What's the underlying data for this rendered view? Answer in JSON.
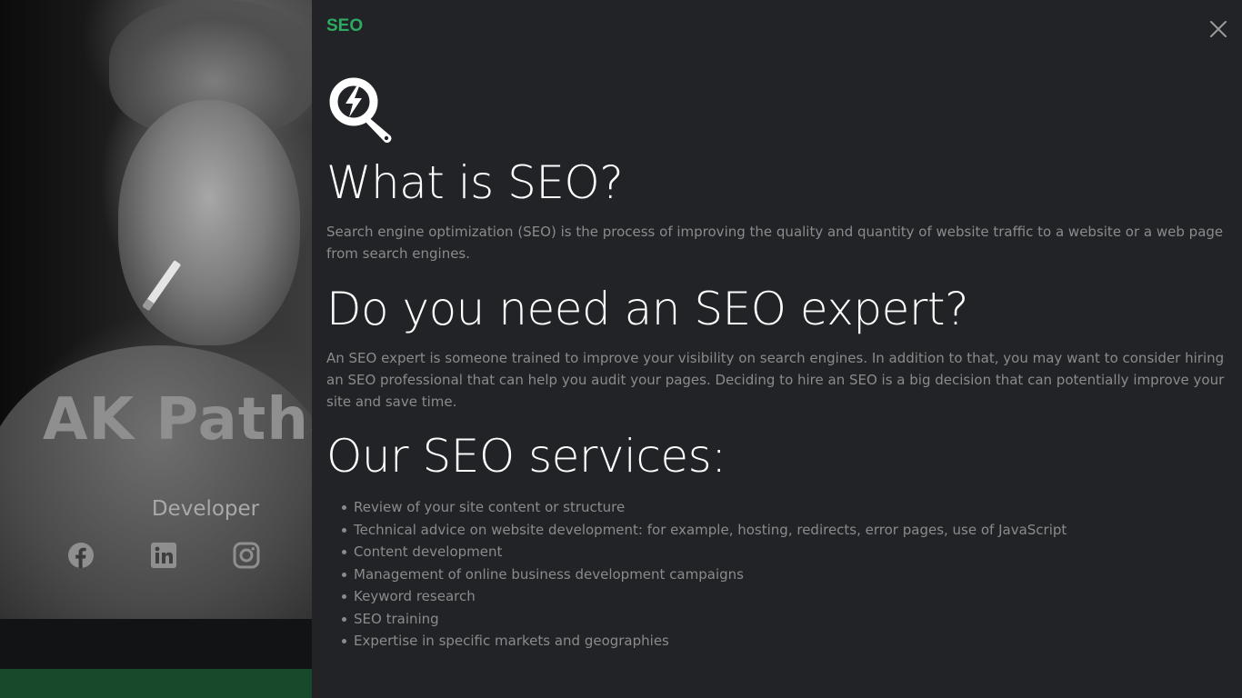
{
  "profile": {
    "name": "AK Patha",
    "role": "Developer",
    "social": [
      "facebook-icon",
      "linkedin-icon",
      "instagram-icon"
    ]
  },
  "modal": {
    "title": "SEO",
    "close_icon": "close-icon",
    "logo_icon": "seo-search-bolt-icon",
    "sections": {
      "what_heading": "What is SEO?",
      "what_text": "Search engine optimization (SEO) is the process of improving the quality and quantity of website traffic to a website or a web page from search engines.",
      "need_heading": "Do you need an SEO expert?",
      "need_text": "An SEO expert is someone trained to improve your visibility on search engines. In addition to that, you may want to consider hiring an SEO professional that can help you audit your pages. Deciding to hire an SEO is a big decision that can potentially improve your site and save time.",
      "services_heading": "Our SEO services:",
      "services": [
        "Review of your site content or structure",
        "Technical advice on website development: for example, hosting, redirects, error pages, use of JavaScript",
        "Content development",
        "Management of online business development campaigns",
        "Keyword research",
        "SEO training",
        "Expertise in specific markets and geographies"
      ]
    }
  },
  "colors": {
    "accent_green": "#2cab61",
    "panel_bg": "#222327",
    "footer_green": "#174a2b"
  }
}
